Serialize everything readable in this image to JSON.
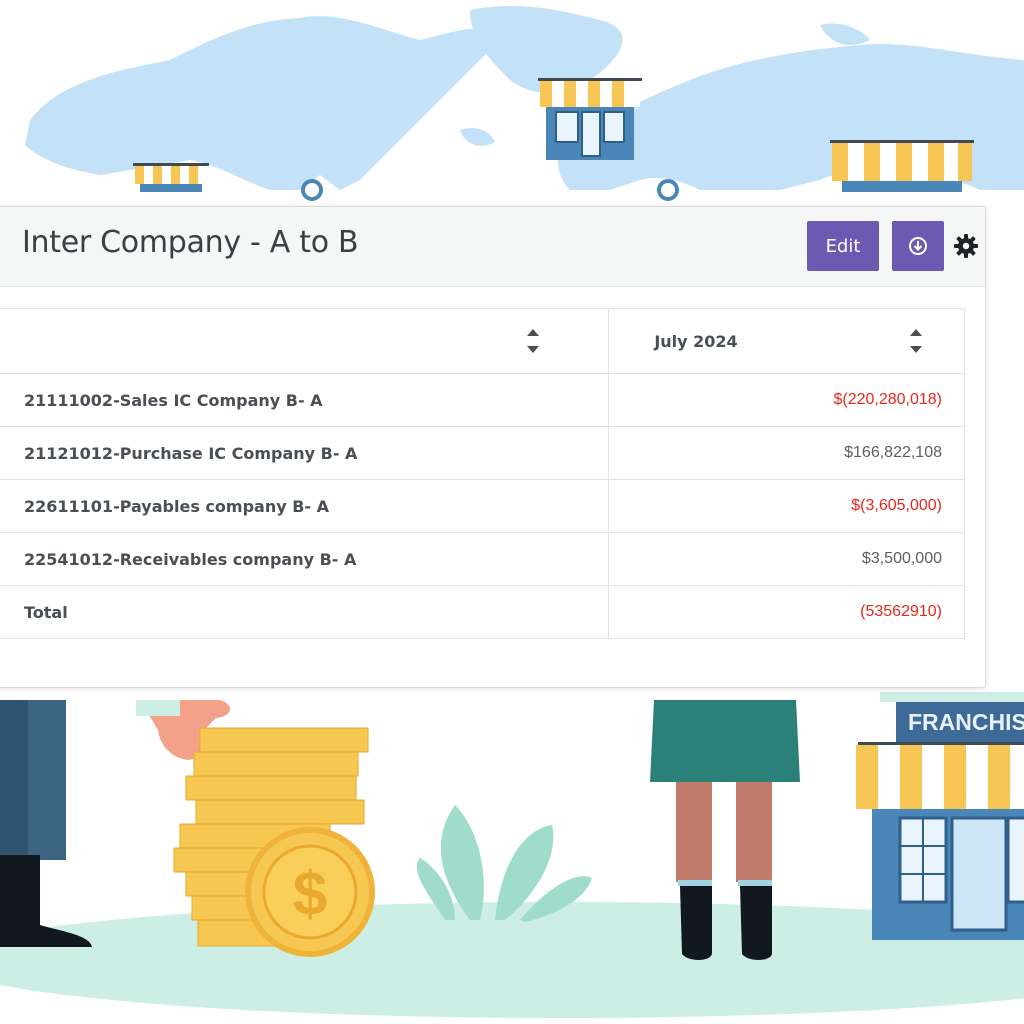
{
  "report": {
    "title": "Inter Company - A to B",
    "edit_label": "Edit",
    "download_icon": "download-circle-icon",
    "settings_icon": "gear-icon"
  },
  "table": {
    "columns": [
      "",
      "July 2024"
    ],
    "rows": [
      {
        "account": "21111002-Sales IC Company B- A",
        "value": "$(220,280,018)",
        "negative": true
      },
      {
        "account": "21121012-Purchase IC Company B- A",
        "value": "$166,822,108",
        "negative": false
      },
      {
        "account": "22611101-Payables company B- A",
        "value": "$(3,605,000)",
        "negative": true
      },
      {
        "account": "22541012-Receivables company B- A",
        "value": "$3,500,000",
        "negative": false
      },
      {
        "account": "Total",
        "value": "(53562910)",
        "negative": true
      }
    ]
  },
  "illustration": {
    "sign_text": "FRANCHIS"
  },
  "colors": {
    "accent": "#6d59b2",
    "negative": "#e8261c",
    "map": "#c4e2f7",
    "ground": "#cdeee5",
    "awning_yellow": "#f7c553",
    "shop_blue": "#4b86b8",
    "coin": "#f7c851"
  }
}
